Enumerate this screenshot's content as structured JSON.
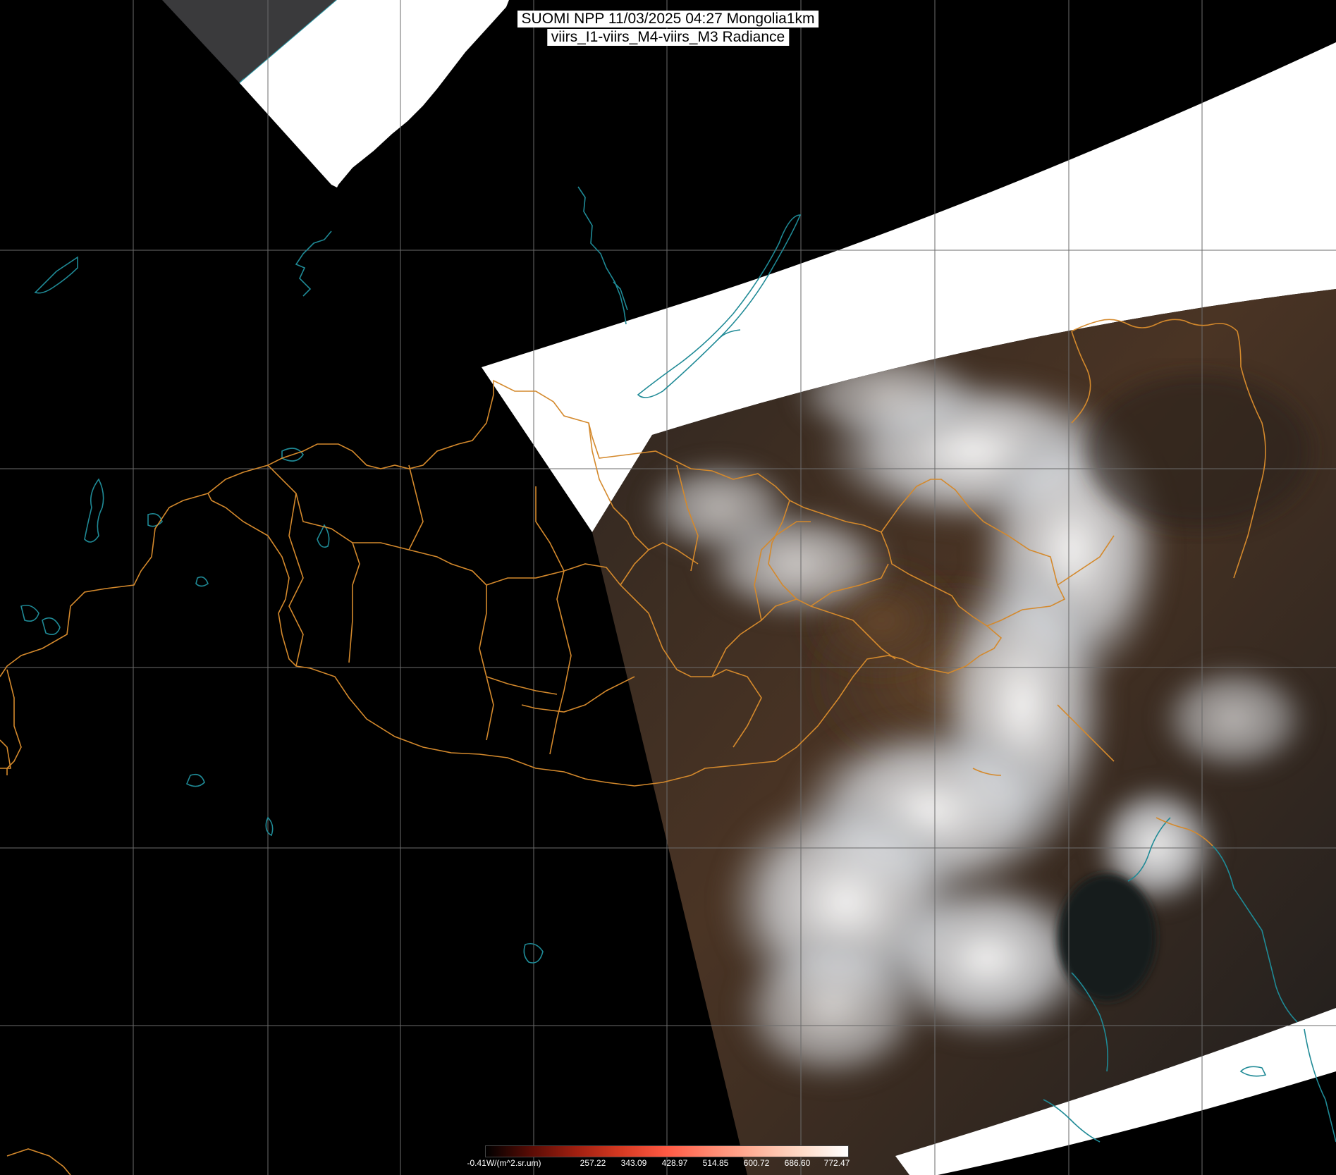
{
  "title": {
    "line1": "SUOMI NPP 11/03/2025 04:27 Mongolia1km",
    "line2": "viirs_I1-viirs_M4-viirs_M3 Radiance"
  },
  "colorbar": {
    "tick_labels": [
      "-0.41W/(m^2.sr.um)",
      "257.22",
      "343.09",
      "428.97",
      "514.85",
      "600.72",
      "686.60",
      "772.47"
    ],
    "gradient_colors": [
      "#000000",
      "#5a0c05",
      "#a01f10",
      "#d63a22",
      "#ff5a44",
      "#ff8a72",
      "#ffb49c",
      "#ffdcc9",
      "#ffffff"
    ]
  },
  "colors": {
    "background": "#000000",
    "saturated_swath": "#ffffff",
    "grid": "#6b6b6b",
    "borders": "#d4892c",
    "water_outlines": "#1f8a96",
    "cloud": "#e6ecf2",
    "land_imagery": "#3e2e22"
  }
}
